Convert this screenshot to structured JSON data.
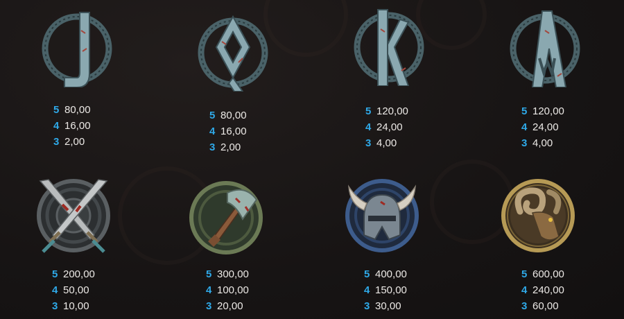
{
  "symbols": [
    {
      "name": "J",
      "icon": "rune-j-icon",
      "pays": [
        {
          "count": "5",
          "amount": "80,00"
        },
        {
          "count": "4",
          "amount": "16,00"
        },
        {
          "count": "3",
          "amount": "2,00"
        }
      ]
    },
    {
      "name": "Q",
      "icon": "rune-q-icon",
      "pays": [
        {
          "count": "5",
          "amount": "80,00"
        },
        {
          "count": "4",
          "amount": "16,00"
        },
        {
          "count": "3",
          "amount": "2,00"
        }
      ]
    },
    {
      "name": "K",
      "icon": "rune-k-icon",
      "pays": [
        {
          "count": "5",
          "amount": "120,00"
        },
        {
          "count": "4",
          "amount": "24,00"
        },
        {
          "count": "3",
          "amount": "4,00"
        }
      ]
    },
    {
      "name": "A",
      "icon": "rune-a-icon",
      "pays": [
        {
          "count": "5",
          "amount": "120,00"
        },
        {
          "count": "4",
          "amount": "24,00"
        },
        {
          "count": "3",
          "amount": "4,00"
        }
      ]
    },
    {
      "name": "swords",
      "icon": "crossed-swords-icon",
      "pays": [
        {
          "count": "5",
          "amount": "200,00"
        },
        {
          "count": "4",
          "amount": "50,00"
        },
        {
          "count": "3",
          "amount": "10,00"
        }
      ]
    },
    {
      "name": "axe",
      "icon": "axe-icon",
      "pays": [
        {
          "count": "5",
          "amount": "300,00"
        },
        {
          "count": "4",
          "amount": "100,00"
        },
        {
          "count": "3",
          "amount": "20,00"
        }
      ]
    },
    {
      "name": "helmet",
      "icon": "horned-helmet-icon",
      "pays": [
        {
          "count": "5",
          "amount": "400,00"
        },
        {
          "count": "4",
          "amount": "150,00"
        },
        {
          "count": "3",
          "amount": "30,00"
        }
      ]
    },
    {
      "name": "ram",
      "icon": "ram-head-icon",
      "pays": [
        {
          "count": "5",
          "amount": "600,00"
        },
        {
          "count": "4",
          "amount": "240,00"
        },
        {
          "count": "3",
          "amount": "60,00"
        }
      ]
    }
  ],
  "colors": {
    "count": "#2fa9e8",
    "amount": "#ece9e6",
    "background": "#1a1717",
    "rune": "#7f9ea6"
  }
}
